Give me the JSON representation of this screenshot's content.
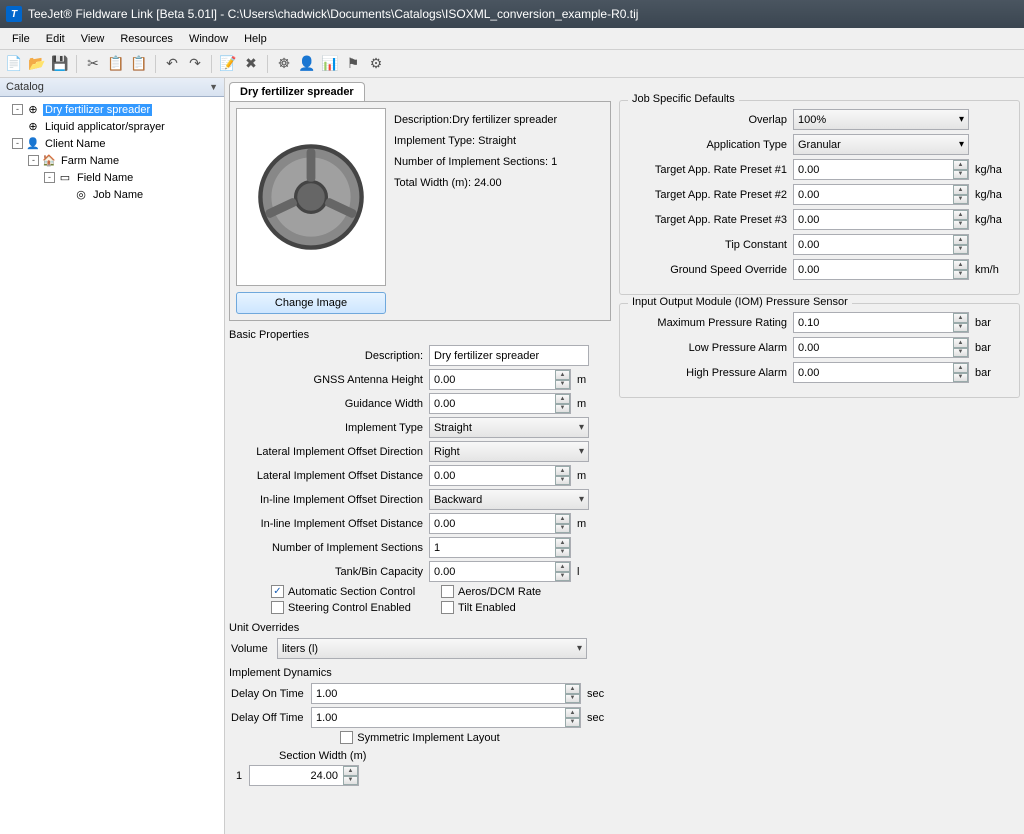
{
  "title": "TeeJet® Fieldware Link [Beta 5.01l] - C:\\Users\\chadwick\\Documents\\Catalogs\\ISOXML_conversion_example-R0.tij",
  "menu": [
    "File",
    "Edit",
    "View",
    "Resources",
    "Window",
    "Help"
  ],
  "catalog": {
    "header": "Catalog",
    "items": [
      {
        "indent": 0,
        "expander": "-",
        "icon": "⊕",
        "label": "Dry fertilizer spreader",
        "selected": true
      },
      {
        "indent": 0,
        "expander": "",
        "icon": "⊕",
        "label": "Liquid applicator/sprayer"
      },
      {
        "indent": 0,
        "expander": "-",
        "icon": "👤",
        "label": "Client Name"
      },
      {
        "indent": 1,
        "expander": "-",
        "icon": "🏠",
        "label": "Farm Name"
      },
      {
        "indent": 2,
        "expander": "-",
        "icon": "▭",
        "label": "Field Name"
      },
      {
        "indent": 3,
        "expander": "",
        "icon": "◎",
        "label": "Job Name"
      }
    ]
  },
  "tab": "Dry fertilizer spreader",
  "preview": {
    "desc_label": "Description:",
    "desc": "Dry fertilizer spreader",
    "impl_type_label": "Implement Type: ",
    "impl_type": "Straight",
    "sections_label": "Number of Implement Sections: ",
    "sections": "1",
    "width_label": "Total Width (m): ",
    "width": "24.00",
    "change_btn": "Change Image"
  },
  "basic": {
    "title": "Basic Properties",
    "description_label": "Description:",
    "description": "Dry fertilizer spreader",
    "gnss_label": "GNSS Antenna Height",
    "gnss": "0.00",
    "gnss_unit": "m",
    "guidance_label": "Guidance Width",
    "guidance": "0.00",
    "guidance_unit": "m",
    "impl_type_label": "Implement Type",
    "impl_type": "Straight",
    "lat_dir_label": "Lateral Implement Offset Direction",
    "lat_dir": "Right",
    "lat_dist_label": "Lateral Implement Offset Distance",
    "lat_dist": "0.00",
    "lat_dist_unit": "m",
    "inline_dir_label": "In-line Implement Offset Direction",
    "inline_dir": "Backward",
    "inline_dist_label": "In-line Implement Offset Distance",
    "inline_dist": "0.00",
    "inline_dist_unit": "m",
    "num_sections_label": "Number of Implement Sections",
    "num_sections": "1",
    "tank_label": "Tank/Bin Capacity",
    "tank": "0.00",
    "tank_unit": "l",
    "asc_label": "Automatic Section Control",
    "asc_checked": true,
    "rate_label": "Aeros/DCM  Rate",
    "rate_checked": false,
    "steer_label": "Steering Control Enabled",
    "steer_checked": false,
    "tilt_label": "Tilt Enabled",
    "tilt_checked": false
  },
  "unit_overrides": {
    "title": "Unit Overrides",
    "volume_label": "Volume",
    "volume": "liters  (l)"
  },
  "dynamics": {
    "title": "Implement Dynamics",
    "on_label": "Delay On Time",
    "on": "1.00",
    "on_unit": "sec",
    "off_label": "Delay Off Time",
    "off": "1.00",
    "off_unit": "sec",
    "symmetric_label": "Symmetric Implement Layout",
    "symmetric_checked": false,
    "section_width_label": "Section Width (m)",
    "section_idx": "1",
    "section_val": "24.00"
  },
  "job_defaults": {
    "title": "Job Specific Defaults",
    "overlap_label": "Overlap",
    "overlap": "100%",
    "app_type_label": "Application Type",
    "app_type": "Granular",
    "preset1_label": "Target App. Rate Preset #1",
    "preset1": "0.00",
    "preset1_unit": "kg/ha",
    "preset2_label": "Target App. Rate Preset #2",
    "preset2": "0.00",
    "preset2_unit": "kg/ha",
    "preset3_label": "Target App. Rate Preset #3",
    "preset3": "0.00",
    "preset3_unit": "kg/ha",
    "tip_label": "Tip Constant",
    "tip": "0.00",
    "gso_label": "Ground Speed Override",
    "gso": "0.00",
    "gso_unit": "km/h"
  },
  "iom": {
    "title": "Input Output Module (IOM) Pressure Sensor",
    "max_label": "Maximum Pressure Rating",
    "max": "0.10",
    "max_unit": "bar",
    "low_label": "Low Pressure Alarm",
    "low": "0.00",
    "low_unit": "bar",
    "high_label": "High Pressure Alarm",
    "high": "0.00",
    "high_unit": "bar"
  }
}
